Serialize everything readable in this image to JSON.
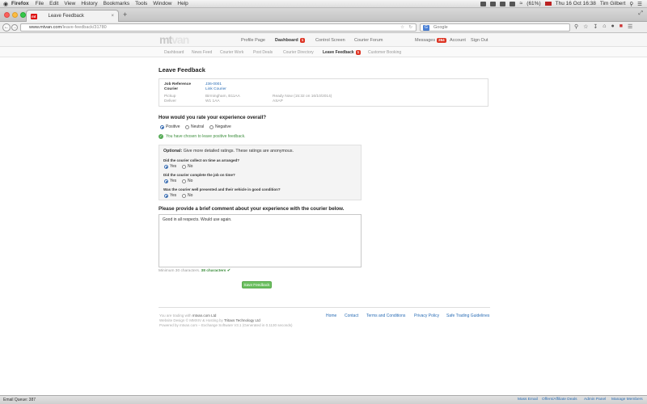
{
  "macmenu": {
    "apple": "",
    "app": "Firefox",
    "items": [
      "File",
      "Edit",
      "View",
      "History",
      "Bookmarks",
      "Tools",
      "Window",
      "Help"
    ],
    "battery": "(61%)",
    "datetime": "Thu 16 Oct  16:38",
    "user": "Tim Gilbert"
  },
  "browser": {
    "tab_title": "Leave Feedback",
    "tab_favicon": "mt",
    "url_host": "www.mtvan.com",
    "url_path": "/leave-feedback/31780",
    "search_placeholder": "Google"
  },
  "site": {
    "logo_mt": "mt",
    "logo_van": "van",
    "nav": {
      "profile": "Profile Page",
      "dashboard": "Dashboard",
      "dashboard_badge": "1",
      "control": "Control Screen",
      "forum": "Courier Forum",
      "messages": "Messages",
      "messages_badge": "264",
      "account": "Account",
      "signout": "Sign Out"
    },
    "subnav": {
      "dashboard": "Dashboard",
      "news": "News Feed",
      "courier_work": "Courier Work",
      "post_deals": "Post Deals",
      "courier_directory": "Courier Directory",
      "leave_feedback": "Leave Feedback",
      "leave_feedback_badge": "1",
      "customer_booking": "Customer Booking"
    }
  },
  "page": {
    "title": "Leave Feedback",
    "job": {
      "ref_label": "Job Reference",
      "ref_value": "J36-0001",
      "courier_label": "Courier",
      "courier_value": "Link Courier",
      "pickup_label": "Pickup",
      "pickup_value": "Birmingham, B11AA",
      "pickup_when": "Ready Now (15:32 on 16/10/2014)",
      "deliver_label": "Deliver",
      "deliver_value": "W1 1AA",
      "deliver_when": "ASAP"
    },
    "rating_question": "How would you rate your experience overall?",
    "rating_options": [
      "Positive",
      "Neutral",
      "Negative"
    ],
    "rating_notice": "You have chosen to leave positive feedback.",
    "optional_bold": "Optional:",
    "optional_text": " Give more detailed ratings. These ratings are anonymous.",
    "detail_questions": [
      "Did the courier collect on time as arranged?",
      "Did the courier complete the job on time?",
      "Was the courier well presented and their vehicle in good condition?"
    ],
    "yes": "Yes",
    "no": "No",
    "comment_question": "Please provide a brief comment about your experience with the courier below.",
    "comment_value": "Good in all respects. Would use again.",
    "min_chars": "Minimum 30 characters.",
    "char_count": "38 characters",
    "submit": "Save Feedback"
  },
  "footer": {
    "line1_prefix": "You are trading with ",
    "line1_brand": "mtvan.com Ltd",
    "line2_prefix": "Website Design © MMXIV & Hosting by ",
    "line2_brand": "Tritaxs Technology Ltd",
    "line3": "Powered by mtvan.com – Exchange Software V3.1 (Generated in 0.1130 seconds)",
    "links": [
      "Home",
      "Contact",
      "Terms and Conditions",
      "Privacy Policy",
      "Safe Trading Guidelines"
    ]
  },
  "statusbar": {
    "email_queue": "Email Queue: 387",
    "links": [
      "Mass Email",
      "Offers/Affiliate Deals",
      "Admin Panel",
      "Manage Members"
    ]
  },
  "colors": {
    "link": "#2a6db5",
    "badge": "#d32f2f",
    "success": "#3f8f3f",
    "button": "#6bbf5f"
  }
}
